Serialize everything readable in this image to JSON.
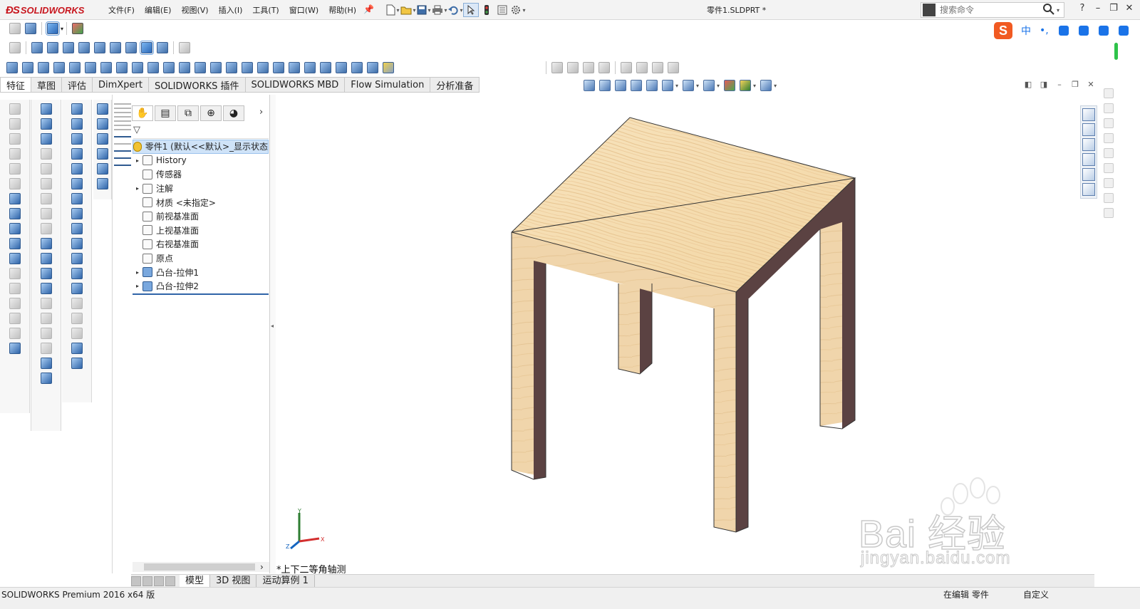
{
  "app": {
    "brand": "SOLIDWORKS",
    "document_title": "零件1.SLDPRT *"
  },
  "menu": [
    "文件(F)",
    "编辑(E)",
    "视图(V)",
    "插入(I)",
    "工具(T)",
    "窗口(W)",
    "帮助(H)"
  ],
  "search": {
    "placeholder": "搜索命令"
  },
  "window_controls": {
    "help": "?",
    "minimize": "–",
    "restore": "❐",
    "close": "✕"
  },
  "ime": {
    "logo": "S",
    "mode": "中",
    "punct": "•,"
  },
  "command_tabs": [
    "特征",
    "草图",
    "评估",
    "DimXpert",
    "SOLIDWORKS 插件",
    "SOLIDWORKS MBD",
    "Flow Simulation",
    "分析准备"
  ],
  "feature_tree": {
    "root": "零件1 (默认<<默认>_显示状态",
    "items": [
      {
        "label": "History",
        "expandable": true
      },
      {
        "label": "传感器",
        "expandable": false
      },
      {
        "label": "注解",
        "expandable": true
      },
      {
        "label": "材质 <未指定>",
        "expandable": false
      },
      {
        "label": "前视基准面",
        "expandable": false
      },
      {
        "label": "上视基准面",
        "expandable": false
      },
      {
        "label": "右视基准面",
        "expandable": false
      },
      {
        "label": "原点",
        "expandable": false
      },
      {
        "label": "凸台-拉伸1",
        "expandable": true
      },
      {
        "label": "凸台-拉伸2",
        "expandable": true
      }
    ]
  },
  "view": {
    "orientation_label": "*上下二等角轴测",
    "triad": {
      "x": "X",
      "y": "Y",
      "z": "Z"
    }
  },
  "bottom_tabs": [
    "模型",
    "3D 视图",
    "运动算例 1"
  ],
  "status": {
    "left": "SOLIDWORKS Premium 2016 x64 版",
    "editing": "在编辑 零件",
    "custom": "自定义"
  },
  "watermark": {
    "brand": "Bai 经验",
    "url": "jingyan.baidu.com"
  },
  "colors": {
    "brand_red": "#c8161e",
    "wood_light": "#f5dcb0",
    "wood_side": "#f0d5ab",
    "wood_shadow": "#5b4242",
    "selection_blue": "#cfe3f8",
    "accent_blue": "#2f64a8"
  }
}
